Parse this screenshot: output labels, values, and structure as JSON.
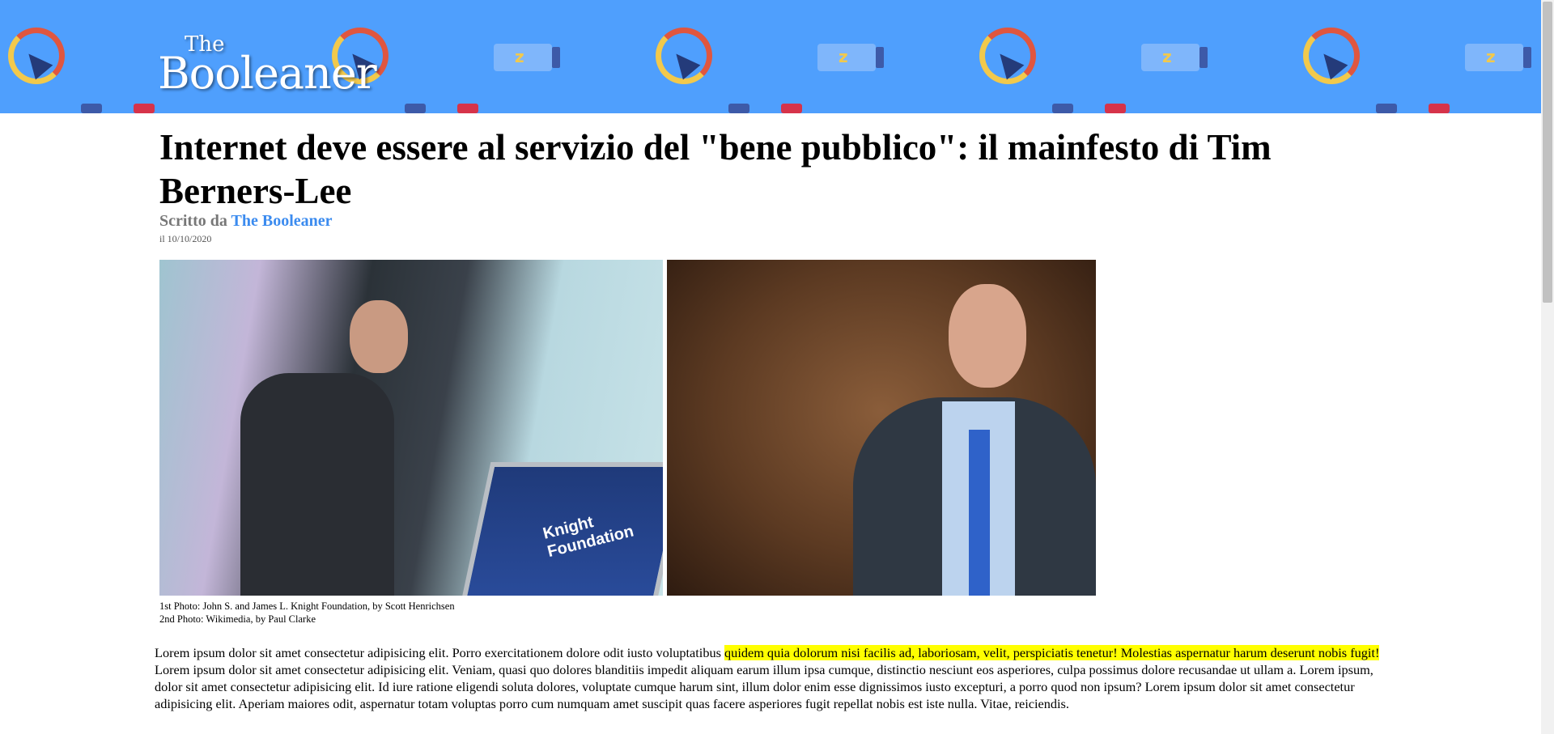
{
  "header": {
    "logo_small": "The",
    "logo_big": "Booleaner",
    "background_color": "#4f9ffd",
    "decor_icons": [
      "gauge-icon",
      "battery-icon",
      "chip-icon"
    ]
  },
  "article": {
    "title": "Internet deve essere al servizio del \"bene pubblico\": il mainfesto di Tim Berners-Lee",
    "byline_prefix": "Scritto da",
    "author": "The Booleaner",
    "date": "il 10/10/2020",
    "podium_text": "Knight Foundation",
    "caption_line1": "1st Photo: John S. and James L. Knight Foundation, by Scott Henrichsen",
    "caption_line2": "2nd Photo: Wikimedia, by Paul Clarke",
    "body_part1": "Lorem ipsum dolor sit amet consectetur adipisicing elit. Porro exercitationem dolore odit iusto voluptatibus ",
    "body_highlight": "quidem quia dolorum nisi facilis ad, laboriosam, velit, perspiciatis tenetur! Molestias aspernatur harum deserunt nobis fugit!",
    "body_part2": " Lorem ipsum dolor sit amet consectetur adipisicing elit. Veniam, quasi quo dolores blanditiis impedit aliquam earum illum ipsa cumque, distinctio nesciunt eos asperiores, culpa possimus dolore recusandae ut ullam a. Lorem ipsum, dolor sit amet consectetur adipisicing elit. Id iure ratione eligendi soluta dolores, voluptate cumque harum sint, illum dolor enim esse dignissimos iusto excepturi, a porro quod non ipsum? Lorem ipsum dolor sit amet consectetur adipisicing elit. Aperiam maiores odit, aspernatur totam voluptas porro cum numquam amet suscipit quas facere asperiores fugit repellat nobis est iste nulla. Vitae, reiciendis.",
    "highlight_color": "#ffff00",
    "author_color": "#3b8bef"
  }
}
